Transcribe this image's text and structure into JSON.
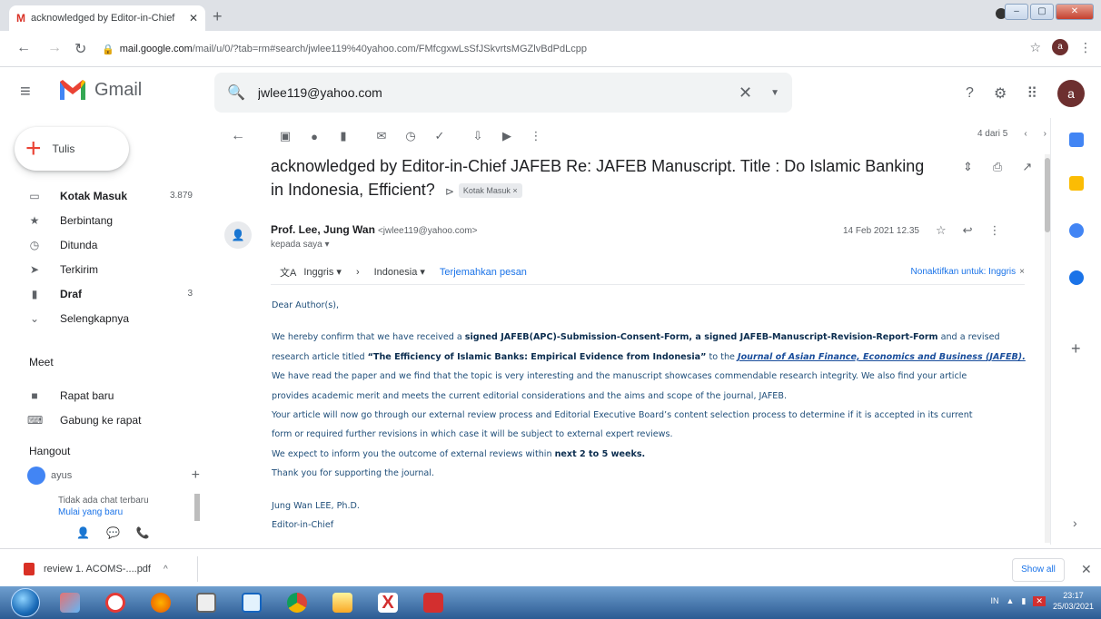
{
  "browser": {
    "tab_title": "acknowledged by Editor-in-Chief",
    "tab_favicon": "M",
    "url_host": "mail.google.com",
    "url_path": "/mail/u/0/?tab=rm#search/jwlee119%40yahoo.com/FMfcgxwLsSfJSkvrtsMGZlvBdPdLcpp",
    "profile_initial": "a"
  },
  "gmail": {
    "brand": "Gmail",
    "search_value": "jwlee119@yahoo.com",
    "account_initial": "a"
  },
  "nav": {
    "compose_label": "Tulis",
    "items": [
      {
        "label": "Kotak Masuk",
        "count": "3.879",
        "icon": "inbox-icon"
      },
      {
        "label": "Berbintang",
        "count": "",
        "icon": "star-icon"
      },
      {
        "label": "Ditunda",
        "count": "",
        "icon": "clock-icon"
      },
      {
        "label": "Terkirim",
        "count": "",
        "icon": "send-icon"
      },
      {
        "label": "Draf",
        "count": "3",
        "icon": "draft-icon"
      },
      {
        "label": "Selengkapnya",
        "count": "",
        "icon": "chevron-down-icon"
      }
    ],
    "meet_title": "Meet",
    "meet_items": [
      {
        "label": "Rapat baru"
      },
      {
        "label": "Gabung ke rapat"
      }
    ],
    "hangout_title": "Hangout",
    "hangout_user": "ayus",
    "no_chat": "Tidak ada chat terbaru",
    "start_chat": "Mulai yang baru"
  },
  "toolbar": {
    "pager": "4 dari 5"
  },
  "message": {
    "subject": "acknowledged by Editor-in-Chief JAFEB Re: JAFEB Manuscript. Title : Do Islamic Banking in Indonesia, Efficient?",
    "label_chip": "Kotak Masuk",
    "sender_name": "Prof. Lee, Jung Wan",
    "sender_email": "<jwlee119@yahoo.com>",
    "to_line": "kepada saya",
    "date": "14 Feb 2021 12.35",
    "translate": {
      "from": "Inggris",
      "to": "Indonesia",
      "action": "Terjemahkan pesan",
      "disable": "Nonaktifkan untuk: Inggris"
    },
    "body": {
      "greeting": "Dear Author(s),",
      "p1_a": "We hereby confirm that we have received a ",
      "p1_b": "signed JAFEB(APC)-Submission-Consent-Form, a signed JAFEB-Manuscript-Revision-Report-Form",
      "p1_c": " and a revised",
      "p2_a": "research article titled ",
      "p2_b": "“The Efficiency of Islamic Banks: Empirical Evidence from Indonesia”",
      "p2_c": " to the ",
      "p2_d": "Journal of Asian Finance, Economics and Business (JAFEB).",
      "p3": "We have read the paper and we find that the topic is very interesting and the manuscript showcases commendable research integrity. We also find your article",
      "p4": "provides academic merit and meets the current editorial considerations and the aims and scope of the journal, JAFEB.",
      "p5": "Your article will now go through our external review process and Editorial Executive Board’s content selection process to determine if it is accepted in its current",
      "p6": "form or required further revisions in which case it will be subject to external expert reviews.",
      "p7_a": "We expect to inform you the outcome of external reviews within ",
      "p7_b": "next 2 to 5 weeks.",
      "p8": "Thank you for supporting the journal.",
      "sig1": "Jung Wan LEE, Ph.D.",
      "sig2": "Editor-in-Chief"
    }
  },
  "download": {
    "file": "review 1. ACOMS-....pdf",
    "show_all": "Show all"
  },
  "taskbar": {
    "lang": "IN",
    "time": "23:17",
    "date": "25/03/2021"
  },
  "colors": {
    "gmail_red": "#ea4335",
    "link_blue": "#1a73e8",
    "body_text": "#1f4e79"
  }
}
